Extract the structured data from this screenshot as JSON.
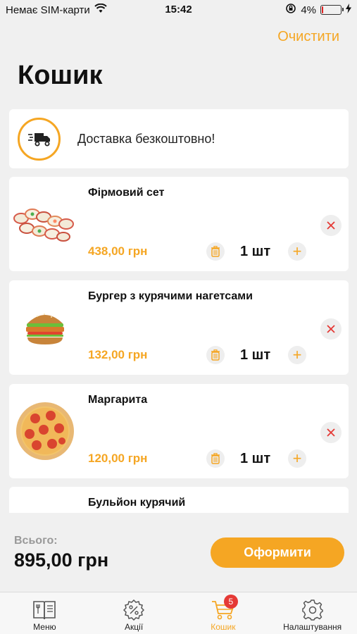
{
  "status_bar": {
    "carrier": "Немає SIM-карти",
    "time": "15:42",
    "battery_percent": "4%",
    "battery_level": 0.04
  },
  "header": {
    "clear_label": "Очистити",
    "title": "Кошик"
  },
  "delivery": {
    "text": "Доставка безкоштовно!",
    "icon": "delivery-truck-icon"
  },
  "items": [
    {
      "name": "Фірмовий сет",
      "price": "438,00 грн",
      "quantity": "1 шт",
      "image": "sushi-set-image"
    },
    {
      "name": "Бургер з курячими нагетсами",
      "price": "132,00 грн",
      "quantity": "1 шт",
      "image": "burger-image"
    },
    {
      "name": "Маргарита",
      "price": "120,00 грн",
      "quantity": "1 шт",
      "image": "pizza-image"
    },
    {
      "name": "Бульйон курячий"
    }
  ],
  "total": {
    "label": "Всього:",
    "value": "895,00 грн"
  },
  "checkout_label": "Оформити",
  "tabs": [
    {
      "label": "Меню",
      "icon": "menu-book-icon"
    },
    {
      "label": "Акції",
      "icon": "discount-gear-icon"
    },
    {
      "label": "Кошик",
      "icon": "cart-icon",
      "active": true,
      "badge": "5"
    },
    {
      "label": "Налаштування",
      "icon": "settings-gear-icon"
    }
  ],
  "colors": {
    "accent": "#f5a623",
    "badge": "#e53935",
    "remove": "#e53935",
    "background": "#f0f0f0"
  }
}
